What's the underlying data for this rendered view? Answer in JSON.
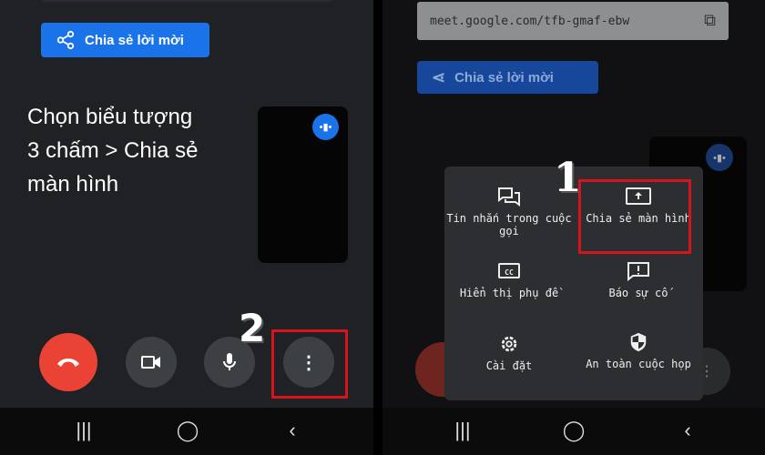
{
  "left": {
    "share_button": {
      "label": "Chia sẻ lời mời",
      "icon": "share-icon"
    },
    "instruction": [
      "Chọn biểu tượng",
      "3 chấm > Chia sẻ",
      "màn hình"
    ],
    "step_number": "2",
    "controls": [
      "end-call-icon",
      "video-icon",
      "mic-icon",
      "more-vert-icon"
    ]
  },
  "right": {
    "meeting_url": "meet.google.com/tfb-gmaf-ebw",
    "share_button": {
      "label": "Chia sẻ lời mời"
    },
    "step_number": "1",
    "menu": [
      {
        "label": "Tin nhắn trong cuộc gọi",
        "icon": "chat-icon"
      },
      {
        "label": "Chia sẻ màn hình",
        "icon": "present-screen-icon"
      },
      {
        "label": "Hiển thị phụ đề",
        "icon": "captions-icon"
      },
      {
        "label": "Báo sự cố",
        "icon": "feedback-icon"
      },
      {
        "label": "Cài đặt",
        "icon": "settings-icon"
      },
      {
        "label": "An toàn cuộc họp",
        "icon": "shield-icon"
      }
    ]
  },
  "colors": {
    "accent": "#1a73e8",
    "end_call": "#ea4335",
    "highlight": "#d7141b"
  }
}
